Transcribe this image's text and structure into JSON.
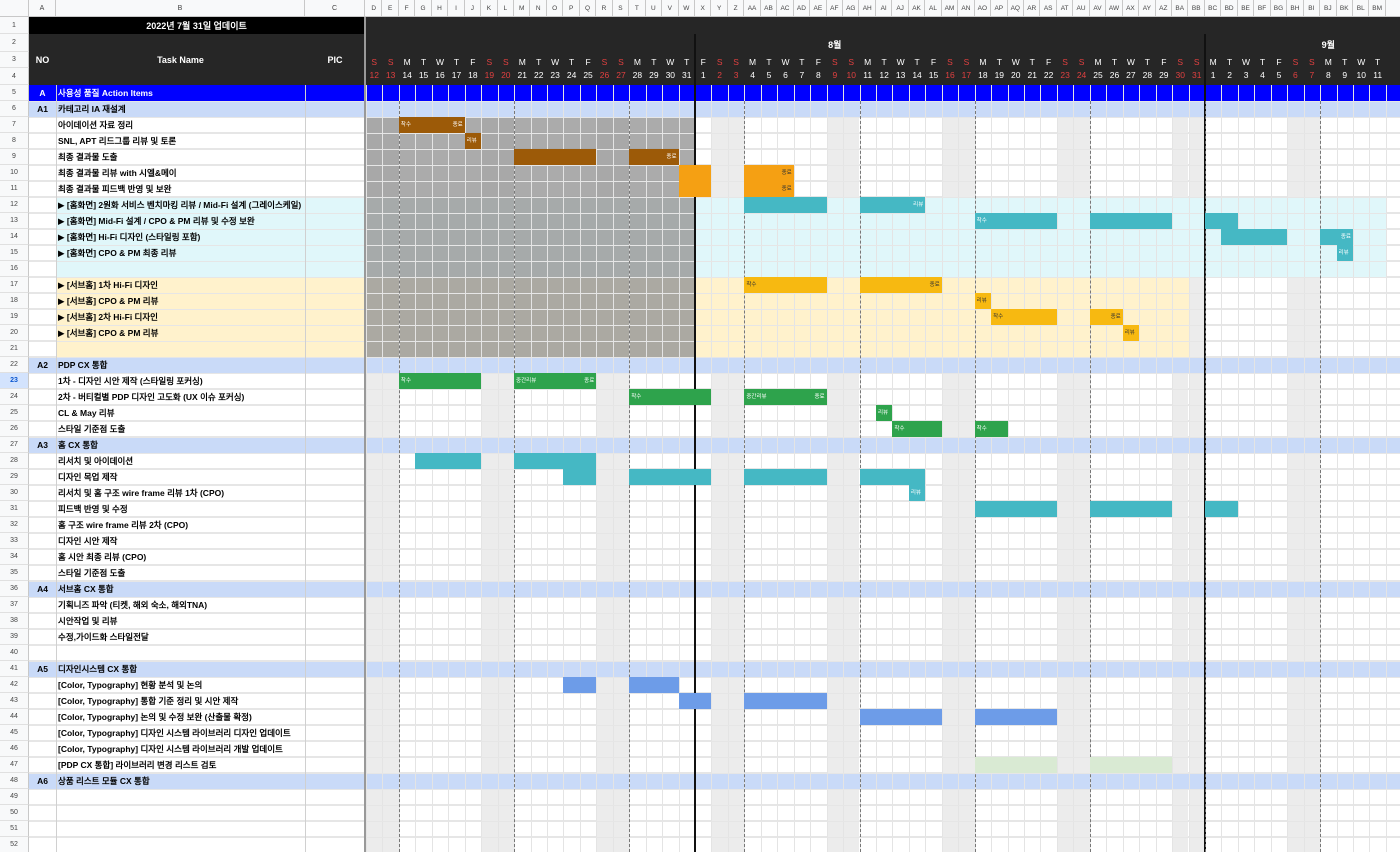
{
  "sheet": {
    "title": "2022년 7월 31일 업데이트",
    "headers": {
      "no": "NO",
      "task": "Task Name",
      "pic": "PIC"
    },
    "months": {
      "aug": "8월",
      "sep": "9월"
    },
    "columns": [
      "A",
      "B",
      "C",
      "D",
      "E",
      "F",
      "G",
      "H",
      "I",
      "J",
      "K",
      "L",
      "M",
      "N",
      "O",
      "P",
      "Q",
      "R",
      "S",
      "T",
      "U",
      "V",
      "W",
      "X",
      "Y",
      "Z",
      "AA",
      "AB",
      "AC",
      "AD",
      "AE",
      "AF",
      "AG",
      "AH",
      "AI",
      "AJ",
      "AK",
      "AL",
      "AM",
      "AN",
      "AO",
      "AP",
      "AQ",
      "AR",
      "AS",
      "AT",
      "AU",
      "AV",
      "AW",
      "AX",
      "AY",
      "AZ",
      "BA",
      "BB",
      "BC",
      "BD",
      "BE",
      "BF",
      "BG",
      "BH",
      "BI",
      "BJ",
      "BK",
      "BL",
      "BM"
    ],
    "weekdays": [
      "S",
      "S",
      "M",
      "T",
      "W",
      "T",
      "F",
      "S",
      "S",
      "M",
      "T",
      "W",
      "T",
      "F",
      "S",
      "S",
      "M",
      "T",
      "W",
      "T",
      "F",
      "S",
      "S",
      "M",
      "T",
      "W",
      "T",
      "F",
      "S",
      "S",
      "M",
      "T",
      "W",
      "T",
      "F",
      "S",
      "S",
      "M",
      "T",
      "W",
      "T",
      "F",
      "S",
      "S",
      "M",
      "T",
      "W",
      "T",
      "F",
      "S",
      "S",
      "M",
      "T",
      "W",
      "T",
      "F",
      "S",
      "S",
      "M",
      "T",
      "W",
      "T"
    ],
    "days": [
      "12",
      "13",
      "14",
      "15",
      "16",
      "17",
      "18",
      "19",
      "20",
      "21",
      "22",
      "23",
      "24",
      "25",
      "26",
      "27",
      "28",
      "29",
      "30",
      "31",
      "1",
      "2",
      "3",
      "4",
      "5",
      "6",
      "7",
      "8",
      "9",
      "10",
      "11",
      "12",
      "13",
      "14",
      "15",
      "16",
      "17",
      "18",
      "19",
      "20",
      "21",
      "22",
      "23",
      "24",
      "25",
      "26",
      "27",
      "28",
      "29",
      "30",
      "31",
      "1",
      "2",
      "3",
      "4",
      "5",
      "6",
      "7",
      "8",
      "9",
      "10",
      "11"
    ],
    "row_numbers": [
      "1",
      "2",
      "3",
      "4",
      "5",
      "6",
      "7",
      "8",
      "9",
      "10",
      "11",
      "12",
      "13",
      "14",
      "15",
      "16",
      "17",
      "18",
      "19",
      "20",
      "21",
      "22",
      "23",
      "24",
      "25",
      "26",
      "27",
      "28",
      "29",
      "30",
      "31",
      "32",
      "33",
      "34",
      "35",
      "36",
      "37",
      "38",
      "39",
      "40",
      "41",
      "42",
      "43",
      "44",
      "45",
      "46",
      "47",
      "48",
      "49",
      "50",
      "51",
      "52"
    ],
    "rows": [
      {
        "no": "A",
        "task": "사용성 품질 Action Items"
      },
      {
        "no": "A1",
        "task": "카테고리 IA 재설계"
      },
      {
        "no": "",
        "task": "아이데이션 자료 정리"
      },
      {
        "no": "",
        "task": "SNL, APT 리드그룹 리뷰 및 토론"
      },
      {
        "no": "",
        "task": "최종 결과물 도출"
      },
      {
        "no": "",
        "task": "최종 결과물 리뷰 with 시엘&메이"
      },
      {
        "no": "",
        "task": "최종 결과물 피드백 반영 및 보완"
      },
      {
        "no": "",
        "task": "▶ [홈화면] 2원화 서비스 벤치마킹 리뷰 / Mid-Fi 설계 (그레이스케일)"
      },
      {
        "no": "",
        "task": "▶ [홈화면] Mid-Fi 설계 / CPO & PM 리뷰 및 수정 보완"
      },
      {
        "no": "",
        "task": "▶ [홈화면] Hi-Fi 디자인 (스타일링 포함)"
      },
      {
        "no": "",
        "task": "▶ [홈화면] CPO & PM 최종 리뷰"
      },
      {
        "no": "",
        "task": ""
      },
      {
        "no": "",
        "task": "▶ [서브홈] 1차 Hi-Fi 디자인"
      },
      {
        "no": "",
        "task": "▶ [서브홈] CPO & PM 리뷰"
      },
      {
        "no": "",
        "task": "▶ [서브홈] 2차 Hi-Fi 디자인"
      },
      {
        "no": "",
        "task": "▶ [서브홈] CPO & PM 리뷰"
      },
      {
        "no": "",
        "task": ""
      },
      {
        "no": "A2",
        "task": "PDP CX 통합"
      },
      {
        "no": "",
        "task": "1차 - 디자인 시안 제작 (스타일링 포커싱)"
      },
      {
        "no": "",
        "task": "2차 - 버티컬별 PDP 디자인 고도화 (UX 이슈 포커싱)"
      },
      {
        "no": "",
        "task": "CL & May 리뷰"
      },
      {
        "no": "",
        "task": "스타일 기준점 도출"
      },
      {
        "no": "A3",
        "task": "홈 CX 통합"
      },
      {
        "no": "",
        "task": "리서치 및 아이데이션"
      },
      {
        "no": "",
        "task": "디자인 목업 제작"
      },
      {
        "no": "",
        "task": "리서치 및 홈 구조 wire frame 리뷰 1차 (CPO)"
      },
      {
        "no": "",
        "task": "피드백 반영 및 수정"
      },
      {
        "no": "",
        "task": "홈 구조 wire frame 리뷰 2차 (CPO)"
      },
      {
        "no": "",
        "task": "디자인 시안 제작"
      },
      {
        "no": "",
        "task": "홈 시안 최종 리뷰 (CPO)"
      },
      {
        "no": "",
        "task": "스타일 기준점 도출"
      },
      {
        "no": "A4",
        "task": "서브홈 CX 통합"
      },
      {
        "no": "",
        "task": "기획니즈 파악 (티켓, 해외 숙소, 해외TNA)"
      },
      {
        "no": "",
        "task": "시안작업 및 리뷰"
      },
      {
        "no": "",
        "task": "수정,가이드화 스타일전달"
      },
      {
        "no": "",
        "task": ""
      },
      {
        "no": "A5",
        "task": "디자인시스템 CX 통합"
      },
      {
        "no": "",
        "task": "[Color, Typography] 현황 분석 및 논의"
      },
      {
        "no": "",
        "task": "[Color, Typography] 통합 기준 정리 및 시안 제작"
      },
      {
        "no": "",
        "task": "[Color, Typography] 논의 및 수정 보완 (산출물 확정)"
      },
      {
        "no": "",
        "task": "[Color, Typography] 디자인 시스템 라이브러리 디자인 업데이트"
      },
      {
        "no": "",
        "task": "[Color, Typography] 디자인 시스템 라이브러리 개발 업데이트"
      },
      {
        "no": "",
        "task": "[PDP CX 통합] 라이브러리 변경 리스트 검토"
      },
      {
        "no": "A6",
        "task": "상품 리스트 모듈 CX 통합"
      },
      {
        "no": "",
        "task": ""
      },
      {
        "no": "",
        "task": ""
      },
      {
        "no": "",
        "task": ""
      },
      {
        "no": "",
        "task": ""
      }
    ],
    "bar_labels": {
      "start": "착수",
      "end": "종료",
      "review": "리뷰",
      "mid_review": "중간리뷰"
    },
    "colors": {
      "brown": "#9c5a08",
      "orange": "#f5a013",
      "teal": "#45b8c4",
      "yellow": "#f7b911",
      "green": "#2ea34c",
      "blue": "#6d9ce8",
      "lightgreen": "#d9ead3",
      "section_a": "#0000ff",
      "subsection": "#c9daf8",
      "cyan_bg": "#e0f7fa",
      "yellow_bg": "#fff2cc",
      "gray_block": "#999999"
    }
  }
}
